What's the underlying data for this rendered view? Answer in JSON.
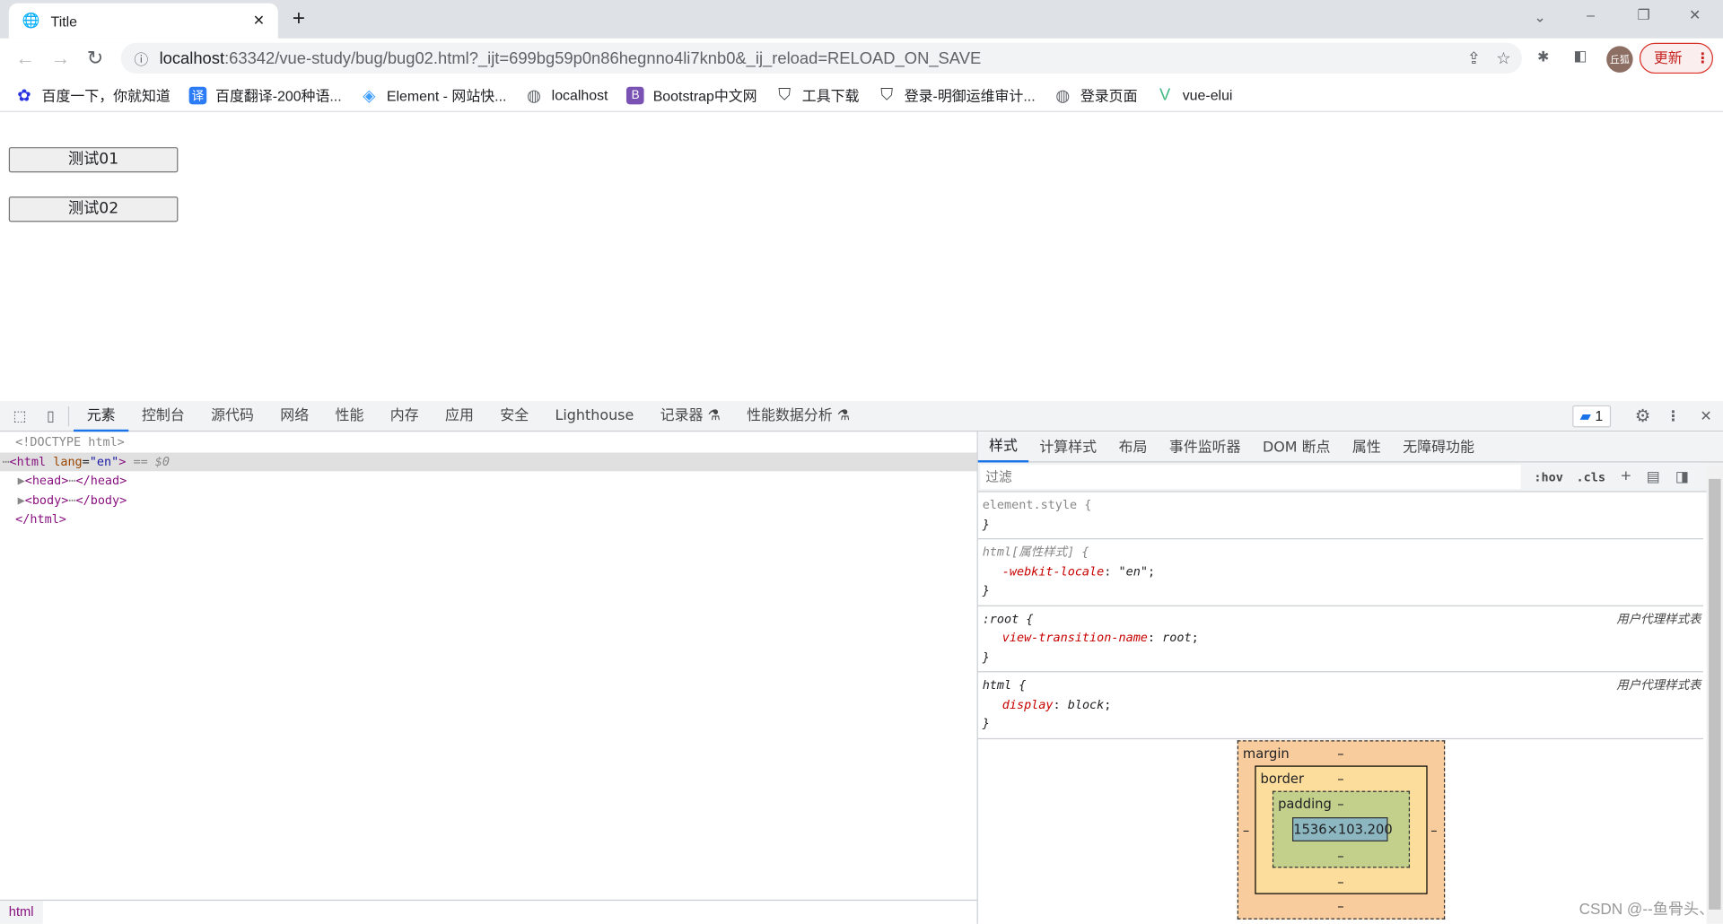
{
  "browser": {
    "tab_title": "Title",
    "url_host": "localhost",
    "url_rest": ":63342/vue-study/bug/bug02.html?_ijt=699bg59p0n86hegnno4li7knb0&_ij_reload=RELOAD_ON_SAVE",
    "profile": "丘狐",
    "update_label": "更新"
  },
  "bookmarks": [
    {
      "label": "百度一下，你就知道",
      "icon": "baidu-paw-icon",
      "color": "#2932e1"
    },
    {
      "label": "百度翻译-200种语...",
      "icon": "translate-icon",
      "color": "#2b7cf6"
    },
    {
      "label": "Element - 网站快...",
      "icon": "element-icon",
      "color": "#409eff"
    },
    {
      "label": "localhost",
      "icon": "globe-icon",
      "color": "#5f6368"
    },
    {
      "label": "Bootstrap中文网",
      "icon": "bootstrap-icon",
      "color": "#7952b3"
    },
    {
      "label": "工具下载",
      "icon": "shield-icon",
      "color": "#3c4043"
    },
    {
      "label": "登录-明御运维审计...",
      "icon": "shield-icon",
      "color": "#3c4043"
    },
    {
      "label": "登录页面",
      "icon": "globe-icon",
      "color": "#5f6368"
    },
    {
      "label": "vue-elui",
      "icon": "vue-icon",
      "color": "#42b883"
    }
  ],
  "page": {
    "button1": "测试01",
    "button2": "测试02"
  },
  "devtools": {
    "tabs": [
      "元素",
      "控制台",
      "源代码",
      "网络",
      "性能",
      "内存",
      "应用",
      "安全",
      "Lighthouse",
      "记录器 ⚗",
      "性能数据分析 ⚗"
    ],
    "issues_count": "1",
    "dom": {
      "doctype": "<!DOCTYPE html>",
      "html_open": "<html",
      "lang_attr": "lang",
      "lang_val": "\"en\"",
      "html_close_br": ">",
      "selected": " == $0",
      "head": "<head>",
      "head_close": "</head>",
      "body": "<body>",
      "body_close": "</body>",
      "html_end": "</html>",
      "ellipsis": "⋯"
    },
    "breadcrumb": "html",
    "styles_tabs": [
      "样式",
      "计算样式",
      "布局",
      "事件监听器",
      "DOM 断点",
      "属性",
      "无障碍功能"
    ],
    "filter_placeholder": "过滤",
    "hov": ":hov",
    "cls": ".cls",
    "rules": [
      {
        "selector": "element.style {",
        "props": [],
        "source": ""
      },
      {
        "selector": "html[属性样式] {",
        "props": [
          {
            "name": "-webkit-locale",
            "value": "\"en\""
          }
        ],
        "source": ""
      },
      {
        "selector": ":root {",
        "props": [
          {
            "name": "view-transition-name",
            "value": "root"
          }
        ],
        "source": "用户代理样式表"
      },
      {
        "selector": "html {",
        "props": [
          {
            "name": "display",
            "value": "block"
          }
        ],
        "source": "用户代理样式表"
      }
    ],
    "box_model": {
      "margin": "margin",
      "border": "border",
      "padding": "padding",
      "dash": "–",
      "content": "1536×103.200"
    }
  },
  "watermark": "CSDN @--鱼骨头、"
}
